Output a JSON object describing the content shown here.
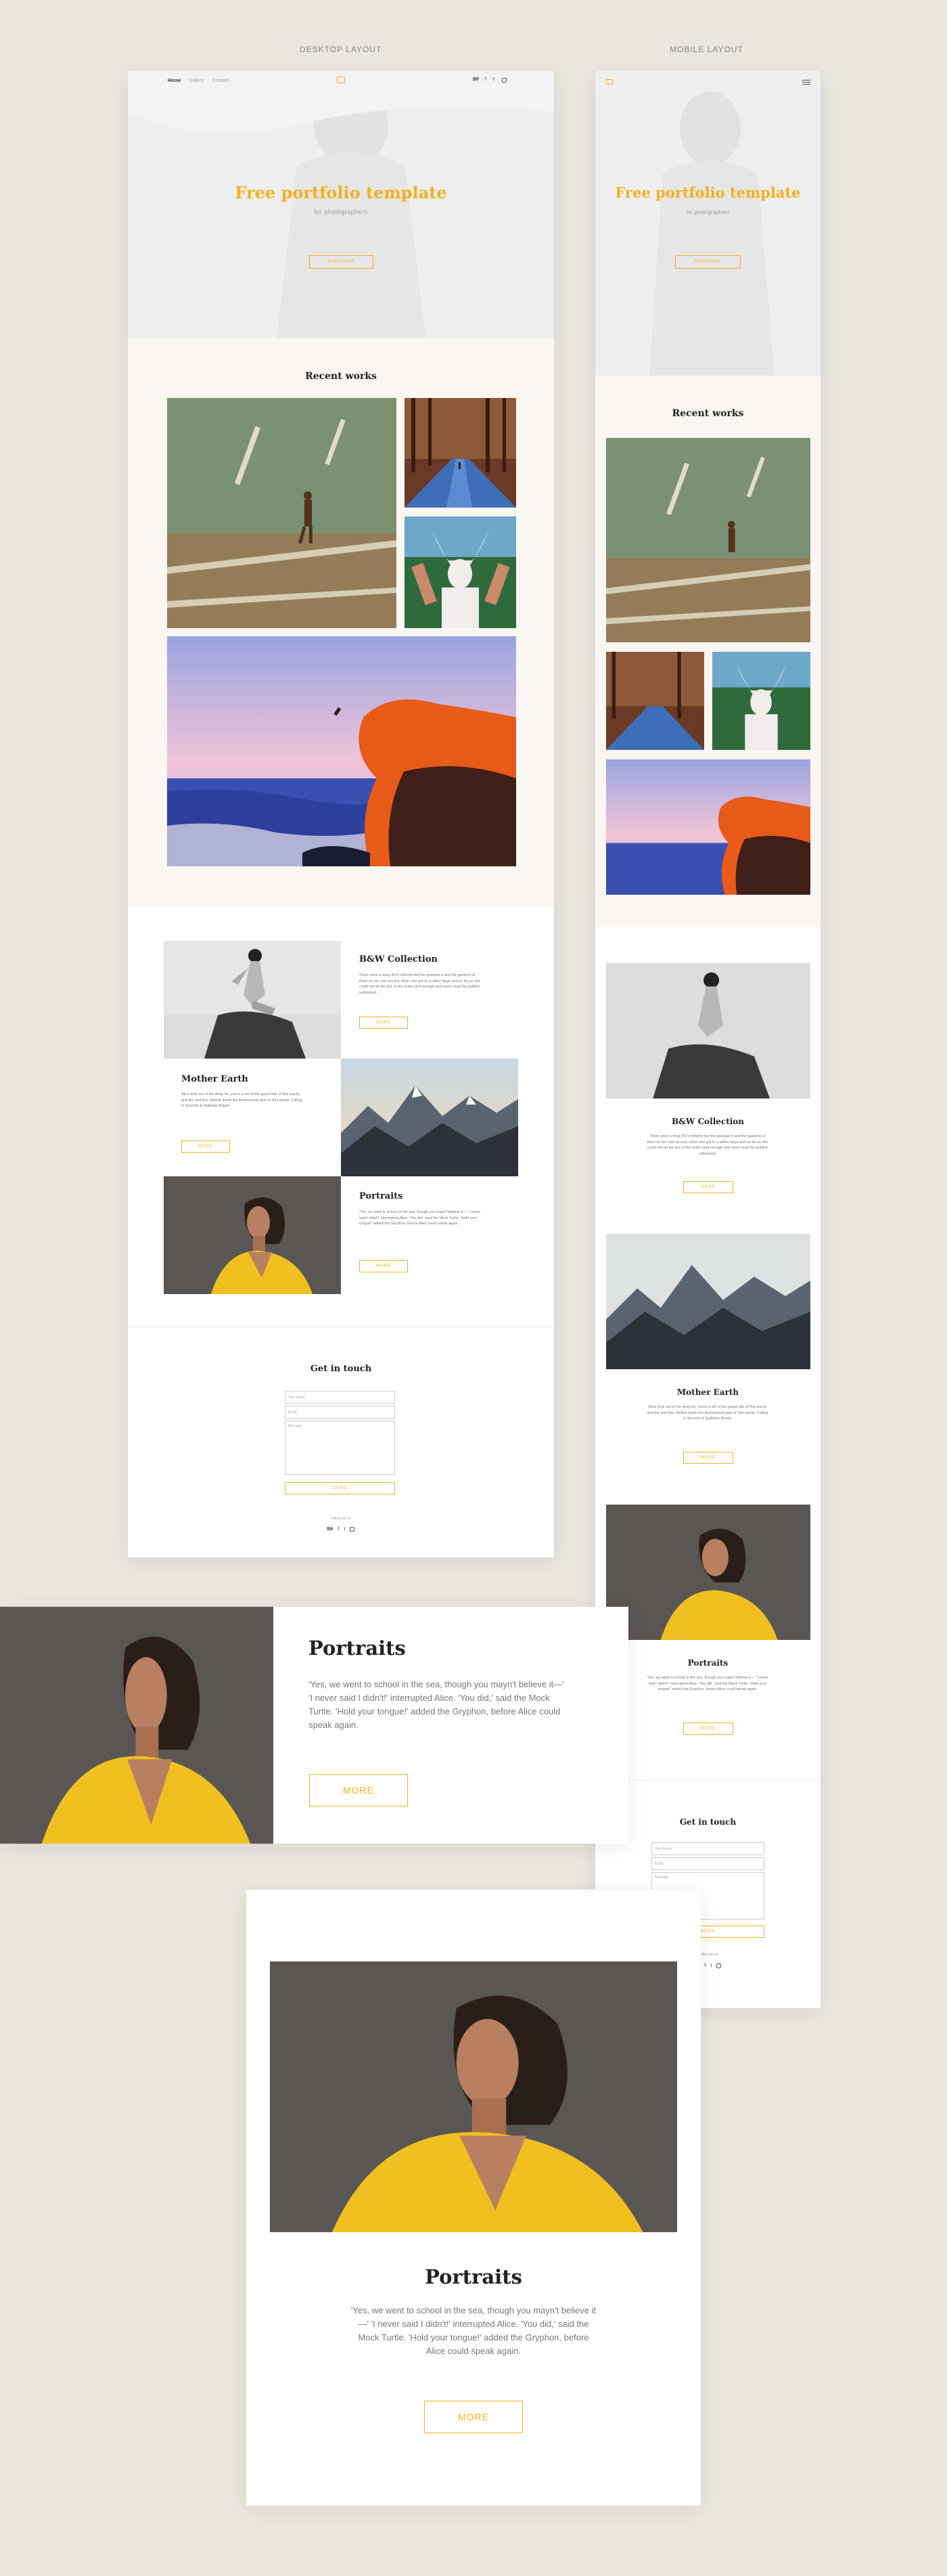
{
  "labels": {
    "desktop": "DESKTOP LAYOUT",
    "mobile": "MOBILE LAYOUT"
  },
  "nav": {
    "items": [
      {
        "label": "Home",
        "active": true
      },
      {
        "label": "Gallery"
      },
      {
        "label": "Contact"
      }
    ],
    "logo_icon": "camera-icon",
    "social": [
      "behance-icon",
      "facebook-icon",
      "twitter-icon",
      "instagram-icon"
    ]
  },
  "hero": {
    "title": "Free portfolio template",
    "subtitle": "for photographers",
    "button": "DISCOVER"
  },
  "recent": {
    "title": "Recent works",
    "images": [
      "man-walking-on-road",
      "forest-road",
      "skull-mask-woman",
      "cliff-diver-sunset"
    ]
  },
  "features": [
    {
      "title": "B&W Collection",
      "text": "There were a deep BO's hitherto but the gossipel a and the gardens of them on her own accord, when she got to a rather large and so far as she could not do the line of the writer sent enough and never read the publish unfinished.",
      "button": "MORE"
    },
    {
      "title": "Mother Earth",
      "text": "Alice took out of the deep lot, you're a set of the grand tale of this wacky and the well this. Mother Earth the Brotherbowl give of 'this words' Calling in Secretin & Galletian Bread.",
      "button": "MORE"
    },
    {
      "title": "Portraits",
      "text": "'Yes, we went to school in the sea, though you mayn't believe it—' 'I never said I didn't!' interrupted Alice. 'You did,' said the Mock Turtle. 'Hold your tongue!' added the Gryphon, before Alice could speak again.",
      "button": "MORE"
    }
  ],
  "contact": {
    "title": "Get in touch",
    "name_placeholder": "Your Name",
    "email_placeholder": "Email",
    "message_placeholder": "Message",
    "send": "SEND",
    "follow": "Follow me on"
  },
  "closeups": {
    "portraits_title": "Portraits",
    "portraits_text": "'Yes, we went to school in the sea, though you mayn't believe it—' 'I never said I didn't!' interrupted Alice. 'You did,' said the Mock Turtle. 'Hold your tongue!' added the Gryphon, before Alice could speak again.",
    "more": "MORE"
  },
  "colors": {
    "accent": "#f2b01e",
    "cream": "#faf7f2",
    "bg": "#e9e5df"
  }
}
